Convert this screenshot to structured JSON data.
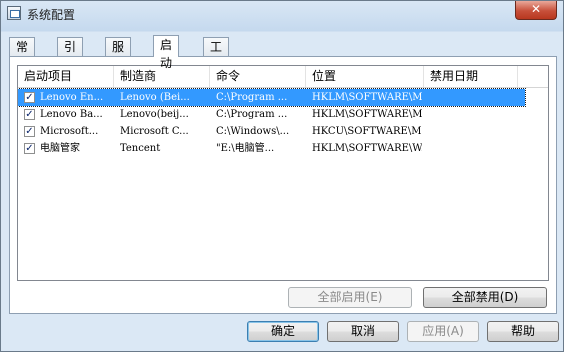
{
  "window": {
    "title": "系统配置",
    "close_label": "✕"
  },
  "tabs": [
    {
      "label": "常规"
    },
    {
      "label": "引导"
    },
    {
      "label": "服务"
    },
    {
      "label": "启动"
    },
    {
      "label": "工具"
    }
  ],
  "list": {
    "columns": [
      "启动项目",
      "制造商",
      "命令",
      "位置",
      "禁用日期"
    ],
    "rows": [
      {
        "checked": true,
        "item": "Lenovo En...",
        "maker": "Lenovo (Bei...",
        "command": "C:\\Program ...",
        "location": "HKLM\\SOFTWARE\\M...",
        "date": ""
      },
      {
        "checked": true,
        "item": "Lenovo Ba...",
        "maker": "Lenovo(beij...",
        "command": "C:\\Program ...",
        "location": "HKLM\\SOFTWARE\\M...",
        "date": ""
      },
      {
        "checked": true,
        "item": "Microsoft...",
        "maker": "Microsoft C...",
        "command": "C:\\Windows\\...",
        "location": "HKCU\\SOFTWARE\\M...",
        "date": ""
      },
      {
        "checked": true,
        "item": "电脑管家",
        "maker": "Tencent",
        "command": "\"E:\\电脑管...",
        "location": "HKLM\\SOFTWARE\\W...",
        "date": ""
      }
    ],
    "checkmark": "✓"
  },
  "buttons": {
    "enable_all": "全部启用(E)",
    "disable_all": "全部禁用(D)",
    "ok": "确定",
    "cancel": "取消",
    "apply": "应用(A)",
    "help": "帮助"
  }
}
